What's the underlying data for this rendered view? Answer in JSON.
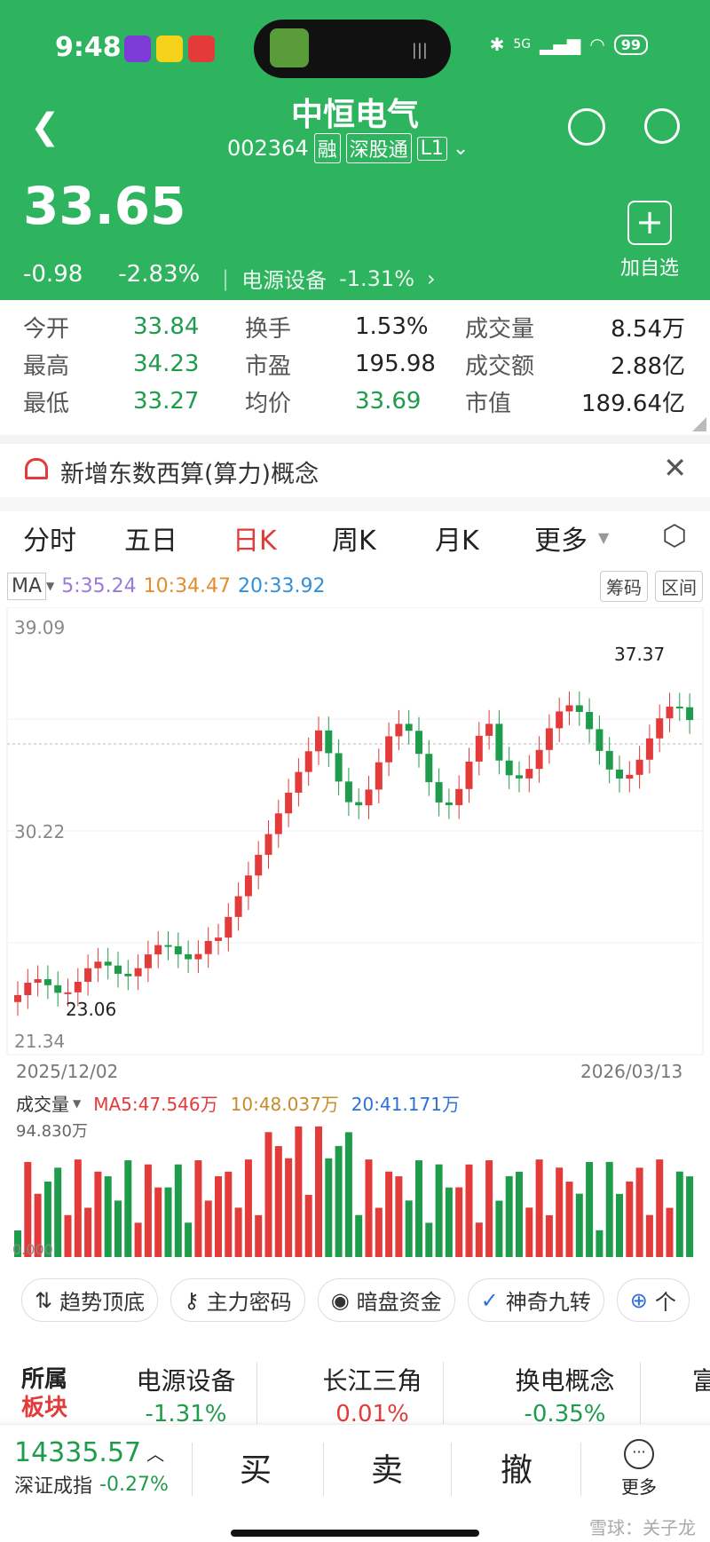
{
  "status_bar": {
    "time": "9:48",
    "network": "5G",
    "battery": "99",
    "island_text": ""
  },
  "header": {
    "title": "中恒电气",
    "code": "002364",
    "badges": [
      "融",
      "深股通",
      "L1"
    ],
    "price": "33.65",
    "change": "-0.98",
    "change_pct": "-2.83%",
    "sector": "电源设备",
    "sector_change": "-1.31%",
    "add_label": "加自选"
  },
  "quote": {
    "rows": [
      [
        {
          "label": "今开",
          "value": "33.84",
          "color": "green"
        },
        {
          "label": "换手",
          "value": "1.53%",
          "color": "dark"
        },
        {
          "label": "成交量",
          "value": "8.54万",
          "color": "dark"
        }
      ],
      [
        {
          "label": "最高",
          "value": "34.23",
          "color": "green"
        },
        {
          "label": "市盈",
          "value": "195.98",
          "color": "dark"
        },
        {
          "label": "成交额",
          "value": "2.88亿",
          "color": "dark"
        }
      ],
      [
        {
          "label": "最低",
          "value": "33.27",
          "color": "green"
        },
        {
          "label": "均价",
          "value": "33.69",
          "color": "green"
        },
        {
          "label": "市值",
          "value": "189.64亿",
          "color": "dark"
        }
      ]
    ]
  },
  "notice": {
    "text": "新增东数西算(算力)概念"
  },
  "tabs": [
    "分时",
    "五日",
    "日K",
    "周K",
    "月K",
    "更多"
  ],
  "active_tab": "日K",
  "ma_bar": {
    "label": "MA",
    "ma5": "5:35.24",
    "ma10": "10:34.47",
    "ma20": "20:33.92",
    "btn1": "筹码",
    "btn2": "区间"
  },
  "colors": {
    "up": "#e33a3a",
    "down": "#1f9c4b",
    "ma5": "#9a7ad8",
    "ma10": "#e38d2f",
    "ma20": "#2f8fd8",
    "header_green": "#2eb45f"
  },
  "chart_data": {
    "type": "candlestick",
    "y_ticks": [
      "39.09",
      "30.22",
      "21.34"
    ],
    "ylim": [
      21.34,
      39.09
    ],
    "x_labels": [
      "2025/12/02",
      "2026/03/13"
    ],
    "high_label": "37.37",
    "low_label": "23.06",
    "volume_label": "成交量",
    "volume_max": "94.830万",
    "volume_min": "0.000",
    "vol_ma5": "MA5:47.546万",
    "vol_ma10": "10:48.037万",
    "vol_ma20": "20:41.171万"
  },
  "tools": [
    "趋势顶底",
    "主力密码",
    "暗盘资金",
    "神奇九转",
    "个"
  ],
  "sectors": {
    "heading1": "所属",
    "heading2": "板块",
    "items": [
      {
        "name": "电源设备",
        "change": "-1.31%"
      },
      {
        "name": "长江三角",
        "change": "0.01%"
      },
      {
        "name": "换电概念",
        "change": "-0.35%"
      },
      {
        "name": "富",
        "change": ""
      }
    ]
  },
  "bottom": {
    "index_value": "14335.57",
    "index_name": "深证成指",
    "index_change": "-0.27%",
    "buy": "买",
    "sell": "卖",
    "cancel": "撤",
    "more": "更多",
    "watermark": "雪球：关子龙"
  }
}
